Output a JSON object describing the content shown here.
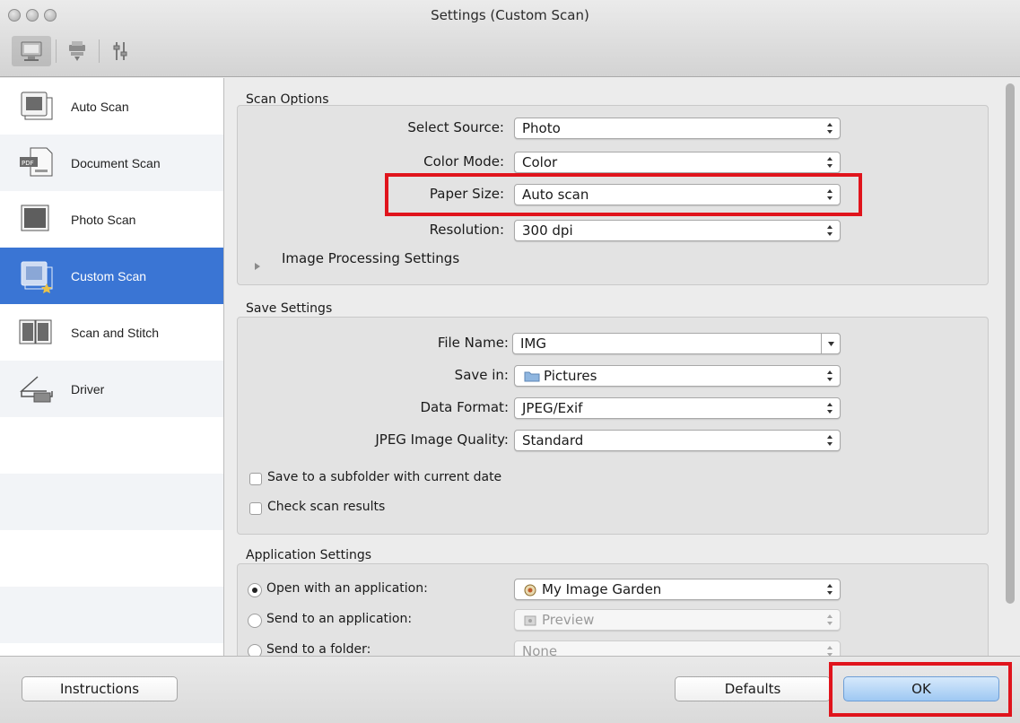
{
  "window": {
    "title": "Settings (Custom Scan)"
  },
  "toolbar": {
    "tabs": [
      {
        "icon": "scan-from-computer-icon"
      },
      {
        "icon": "scan-from-operation-panel-icon"
      },
      {
        "icon": "general-settings-icon"
      }
    ]
  },
  "sidebar": {
    "items": [
      {
        "label": "Auto Scan",
        "icon": "auto-scan-icon"
      },
      {
        "label": "Document Scan",
        "icon": "document-scan-icon"
      },
      {
        "label": "Photo Scan",
        "icon": "photo-scan-icon"
      },
      {
        "label": "Custom Scan",
        "icon": "custom-scan-icon",
        "selected": true
      },
      {
        "label": "Scan and Stitch",
        "icon": "scan-and-stitch-icon"
      },
      {
        "label": "Driver",
        "icon": "driver-icon"
      }
    ]
  },
  "scan_options": {
    "title": "Scan Options",
    "select_source": {
      "label": "Select Source:",
      "value": "Photo"
    },
    "color_mode": {
      "label": "Color Mode:",
      "value": "Color"
    },
    "paper_size": {
      "label": "Paper Size:",
      "value": "Auto scan"
    },
    "resolution": {
      "label": "Resolution:",
      "value": "300 dpi"
    },
    "image_processing": "Image Processing Settings"
  },
  "save_settings": {
    "title": "Save Settings",
    "file_name": {
      "label": "File Name:",
      "value": "IMG"
    },
    "save_in": {
      "label": "Save in:",
      "value": "Pictures"
    },
    "data_format": {
      "label": "Data Format:",
      "value": "JPEG/Exif"
    },
    "jpeg_quality": {
      "label": "JPEG Image Quality:",
      "value": "Standard"
    },
    "subfolder": {
      "label": "Save to a subfolder with current date",
      "checked": false
    },
    "check_results": {
      "label": "Check scan results",
      "checked": false
    }
  },
  "application_settings": {
    "title": "Application Settings",
    "open_with": {
      "label": "Open with an application:",
      "value": "My Image Garden",
      "selected": true
    },
    "send_to_app": {
      "label": "Send to an application:",
      "value": "Preview",
      "selected": false
    },
    "send_to_folder": {
      "label": "Send to a folder:",
      "value": "None",
      "selected": false
    }
  },
  "footer": {
    "instructions_label": "Instructions",
    "defaults_label": "Defaults",
    "ok_label": "OK"
  },
  "colors": {
    "selection_blue": "#3a75d4",
    "highlight_red": "#e0141c"
  }
}
